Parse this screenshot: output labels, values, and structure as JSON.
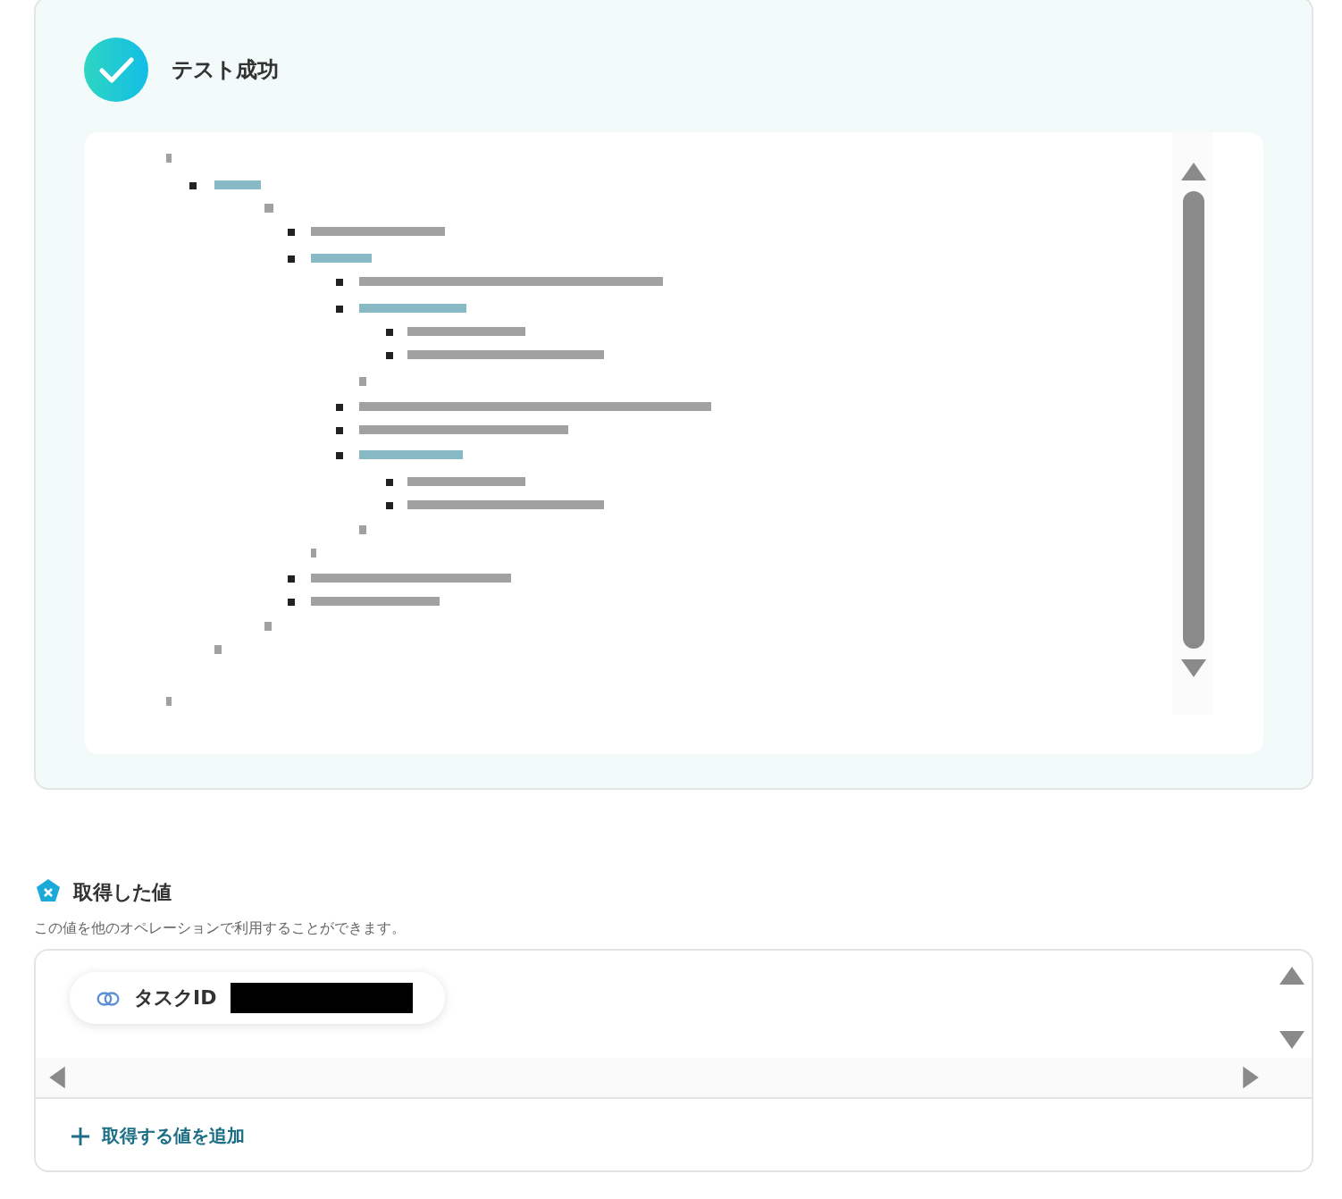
{
  "result": {
    "title": "テスト成功",
    "kind": "success"
  },
  "outputs": {
    "title": "取得した値",
    "description": "この値を他のオペレーションで利用することができます。",
    "items": [
      {
        "label": "タスクID"
      }
    ],
    "add_label": "取得する値を追加"
  }
}
